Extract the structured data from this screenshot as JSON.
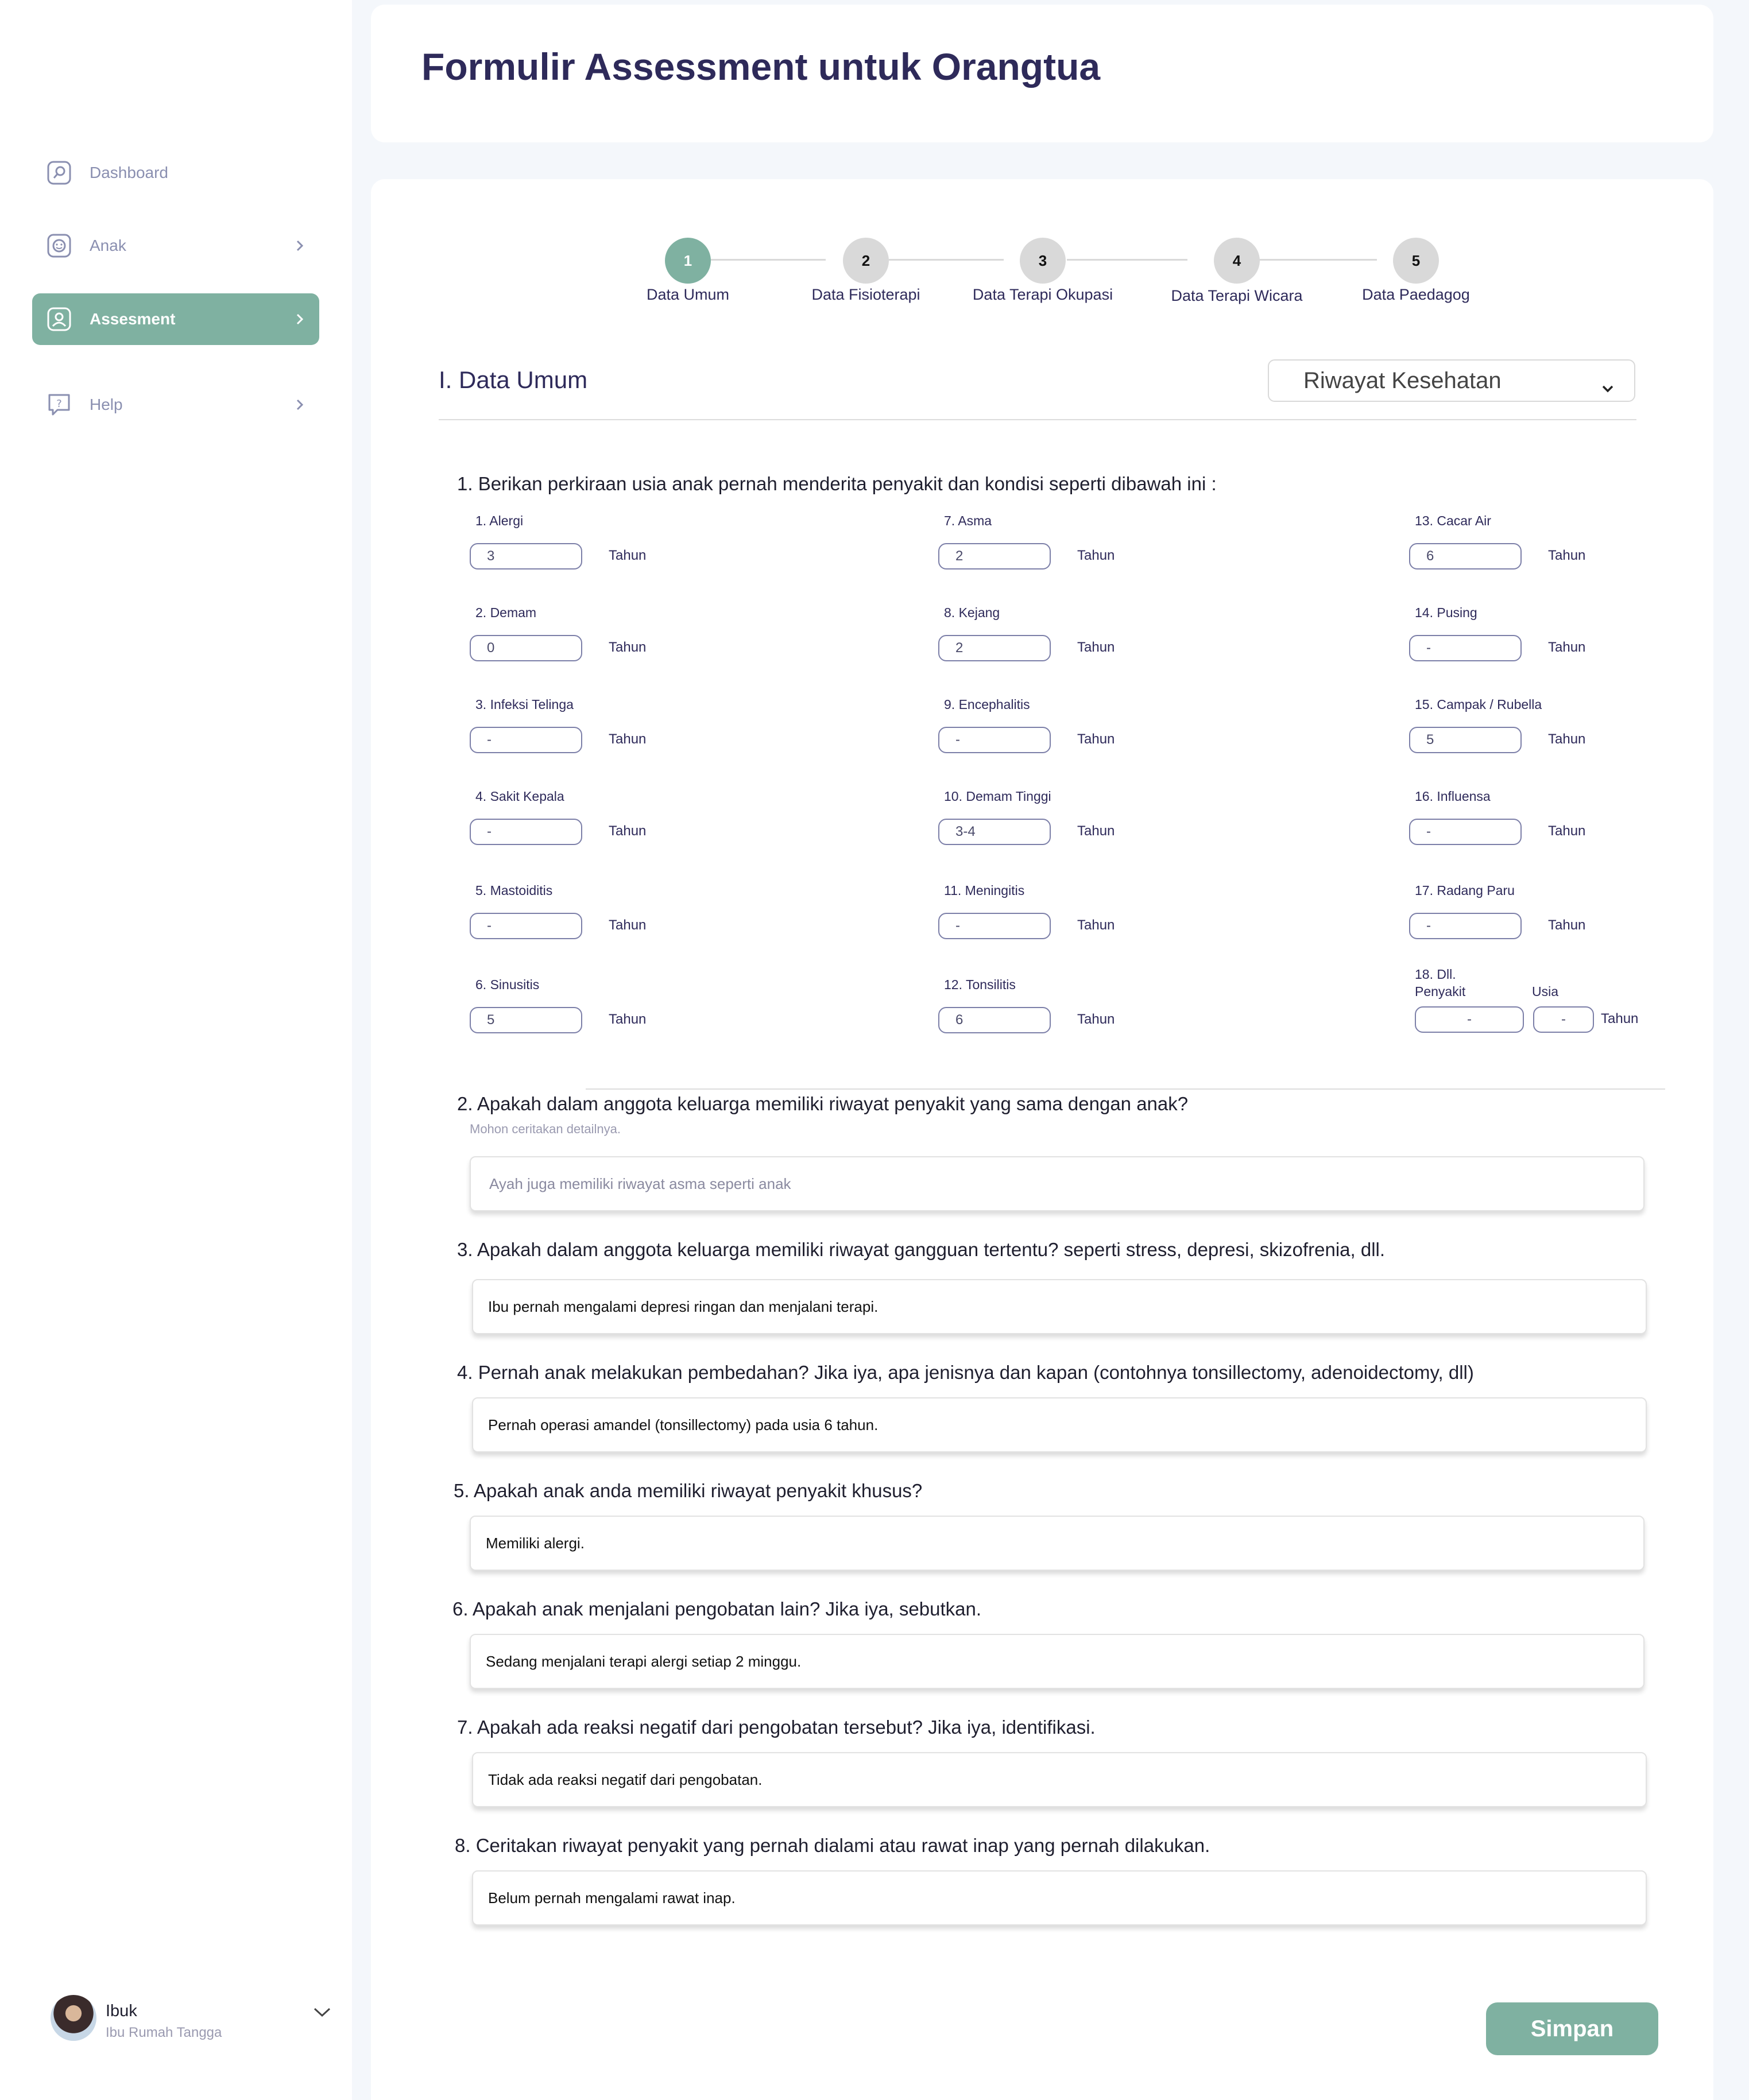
{
  "sidebar": {
    "items": [
      {
        "label": "Dashboard",
        "icon": "dashboard-icon"
      },
      {
        "label": "Anak",
        "icon": "child-icon"
      },
      {
        "label": "Assesment",
        "icon": "assessment-icon"
      },
      {
        "label": "Help",
        "icon": "help-icon"
      }
    ],
    "user": {
      "name": "Ibuk",
      "role": "Ibu Rumah Tangga"
    }
  },
  "header": {
    "title": "Formulir Assessment untuk Orangtua"
  },
  "stepper": [
    {
      "number": "1",
      "label": "Data Umum"
    },
    {
      "number": "2",
      "label": "Data Fisioterapi"
    },
    {
      "number": "3",
      "label": "Data Terapi Okupasi"
    },
    {
      "number": "4",
      "label": "Data Terapi Wicara"
    },
    {
      "number": "5",
      "label": "Data Paedagog"
    }
  ],
  "section": {
    "title": "I. Data Umum",
    "dropdown_value": "Riwayat Kesehatan"
  },
  "q1": {
    "text": "1. Berikan perkiraan usia anak pernah menderita penyakit dan kondisi seperti dibawah ini :",
    "unit": "Tahun",
    "diseases": [
      {
        "label": "1. Alergi",
        "value": "3"
      },
      {
        "label": "2. Demam",
        "value": "0"
      },
      {
        "label": "3. Infeksi Telinga",
        "value": "-"
      },
      {
        "label": "4. Sakit Kepala",
        "value": "-"
      },
      {
        "label": "5. Mastoiditis",
        "value": "-"
      },
      {
        "label": "6. Sinusitis",
        "value": "5"
      },
      {
        "label": "7. Asma",
        "value": "2"
      },
      {
        "label": "8. Kejang",
        "value": "2"
      },
      {
        "label": "9. Encephalitis",
        "value": "-"
      },
      {
        "label": "10. Demam Tinggi",
        "value": "3-4"
      },
      {
        "label": "11. Meningitis",
        "value": "-"
      },
      {
        "label": "12. Tonsilitis",
        "value": "6"
      },
      {
        "label": "13. Cacar Air",
        "value": "6"
      },
      {
        "label": "14. Pusing",
        "value": "-"
      },
      {
        "label": "15. Campak / Rubella",
        "value": "5"
      },
      {
        "label": "16. Influensa",
        "value": "-"
      },
      {
        "label": "17. Radang Paru",
        "value": "-"
      }
    ],
    "other": {
      "label_line1": "18. Dll.",
      "label_line2": "Penyakit",
      "usia_label": "Usia",
      "disease_value": "-",
      "age_value": "-"
    }
  },
  "questions": [
    {
      "text": "2. Apakah dalam anggota keluarga memiliki riwayat penyakit yang sama dengan anak?",
      "hint": "Mohon ceritakan detailnya.",
      "answer": "Ayah juga memiliki riwayat asma seperti anak"
    },
    {
      "text": "3. Apakah dalam anggota keluarga memiliki riwayat gangguan tertentu? seperti stress, depresi, skizofrenia, dll.",
      "answer": "Ibu pernah mengalami depresi ringan dan menjalani terapi."
    },
    {
      "text": "4. Pernah anak melakukan pembedahan? Jika iya, apa jenisnya dan kapan (contohnya tonsillectomy, adenoidectomy, dll)",
      "answer": "Pernah operasi amandel (tonsillectomy) pada usia 6 tahun."
    },
    {
      "text": "5. Apakah anak anda memiliki riwayat penyakit khusus?",
      "answer": "Memiliki alergi."
    },
    {
      "text": "6. Apakah anak menjalani pengobatan lain? Jika iya, sebutkan.",
      "answer": "Sedang menjalani terapi alergi setiap 2 minggu."
    },
    {
      "text": "7. Apakah ada reaksi negatif dari pengobatan tersebut? Jika iya, identifikasi.",
      "answer": "Tidak ada reaksi negatif dari pengobatan."
    },
    {
      "text": "8. Ceritakan riwayat penyakit yang pernah dialami atau rawat inap yang pernah dilakukan.",
      "answer": "Belum pernah mengalami rawat inap."
    }
  ],
  "actions": {
    "save_label": "Simpan"
  },
  "colors": {
    "accent": "#7fb1a1",
    "title": "#2e2a5a",
    "inactive_step": "#d9d9d9"
  }
}
